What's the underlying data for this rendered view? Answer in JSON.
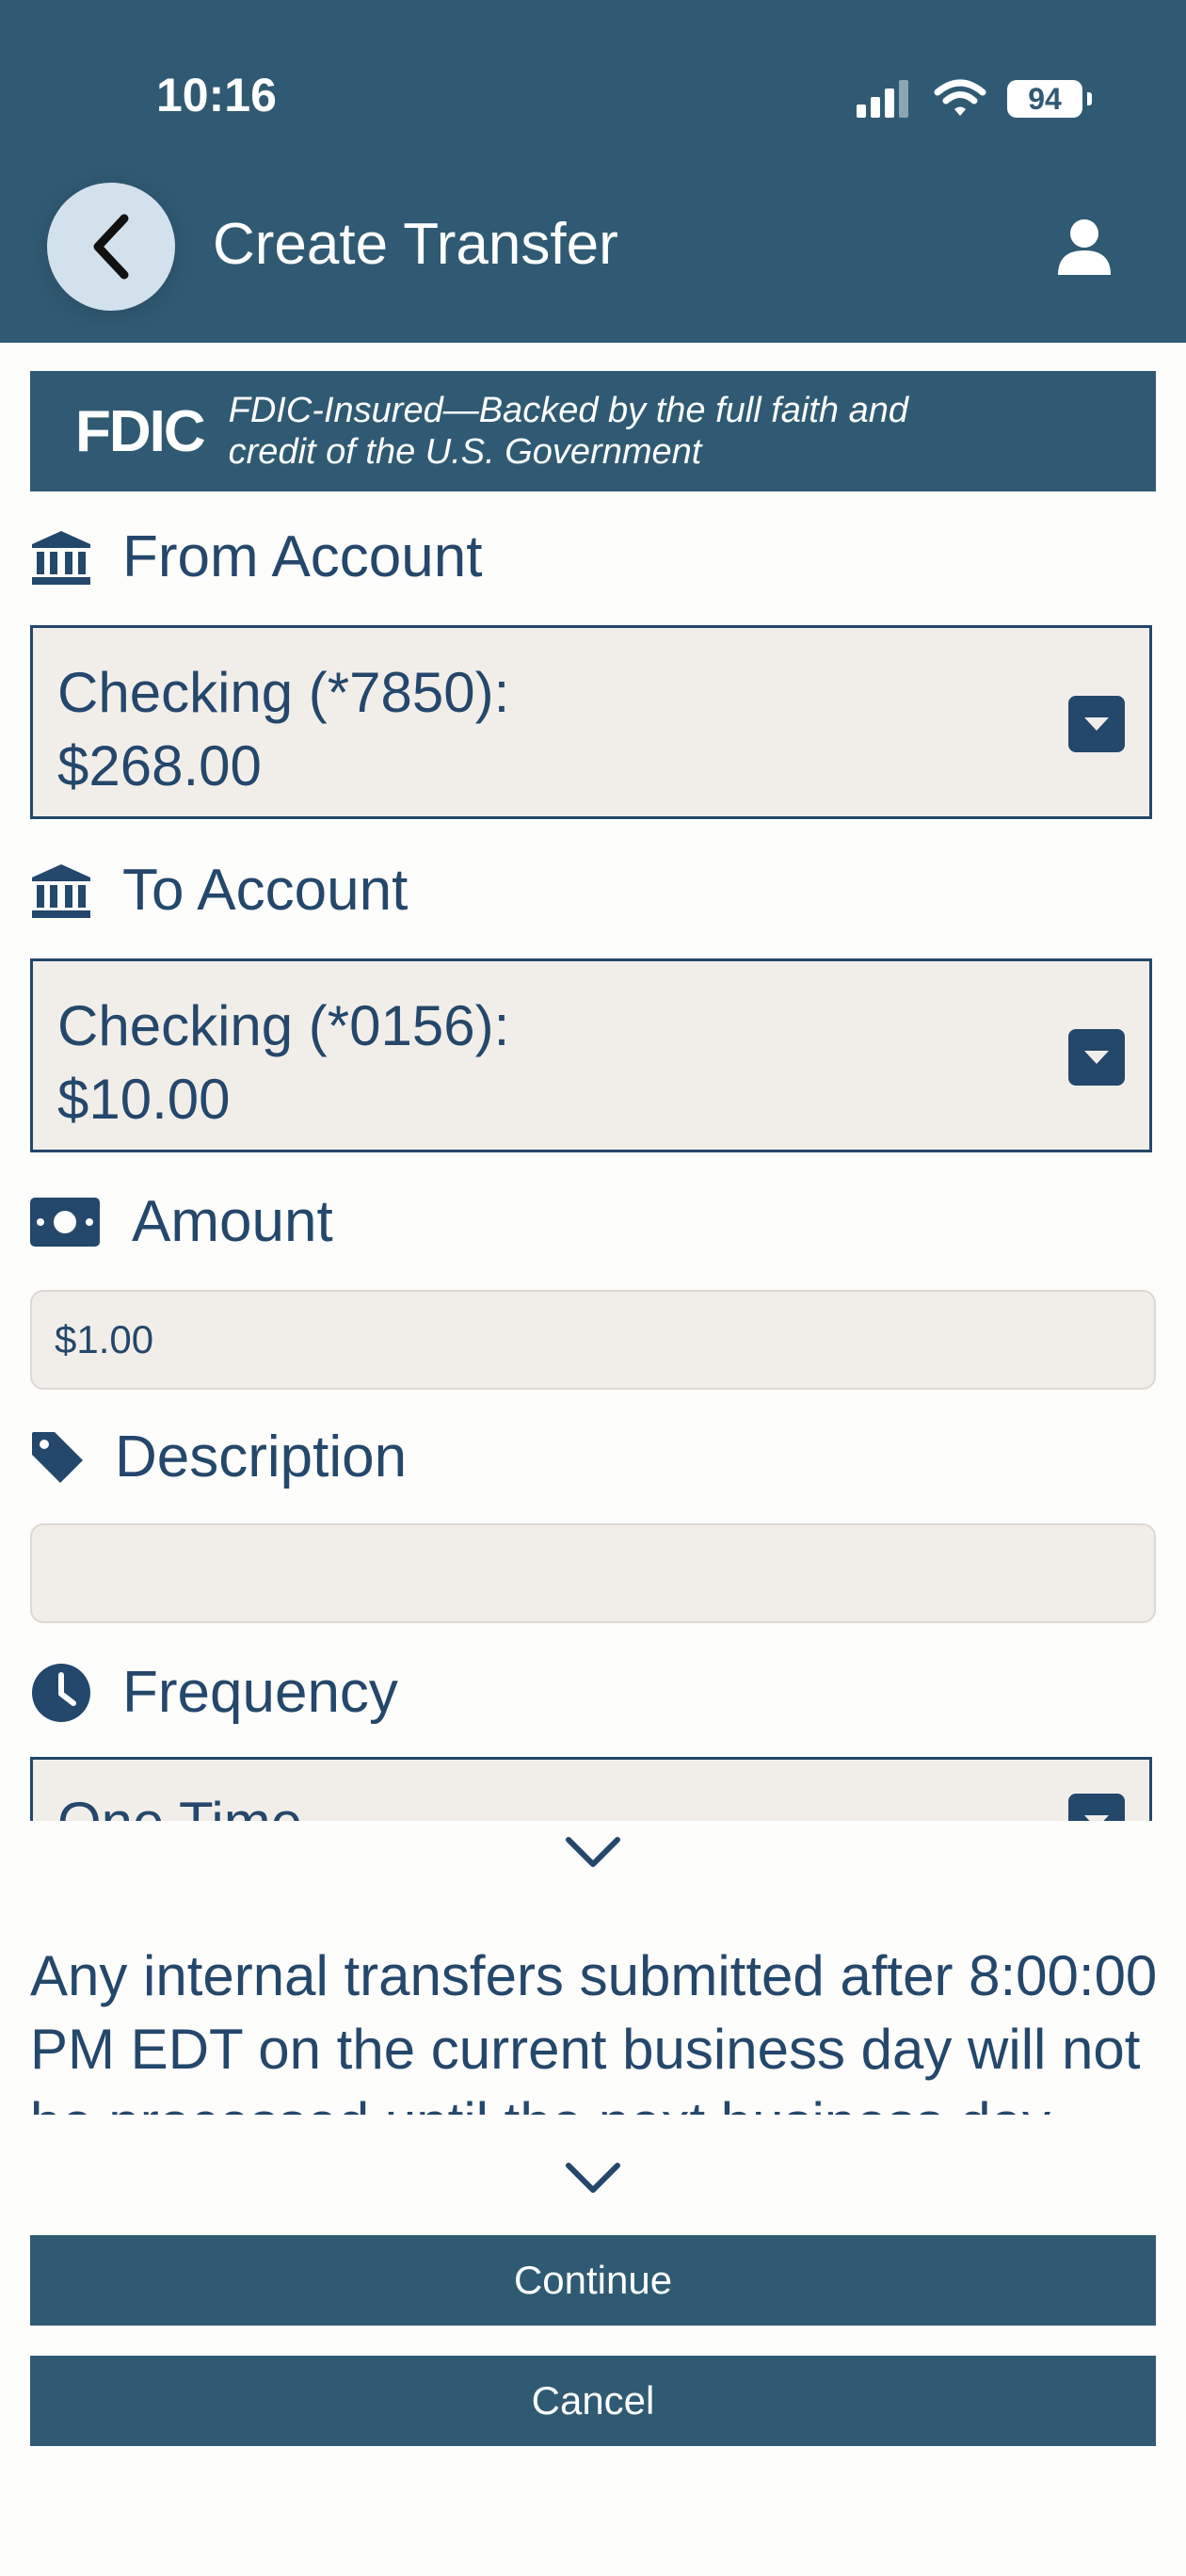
{
  "status_bar": {
    "time": "10:16",
    "battery": "94"
  },
  "header": {
    "title": "Create Transfer"
  },
  "fdic": {
    "logo": "FDIC",
    "line1": "FDIC-Insured—Backed by the full faith and",
    "line2": "credit of the U.S. Government"
  },
  "from_account": {
    "label": "From Account",
    "line1": "Checking (*7850):",
    "line2": "$268.00"
  },
  "to_account": {
    "label": "To Account",
    "line1": "Checking (*0156):",
    "line2": "$10.00"
  },
  "amount": {
    "label": "Amount",
    "value": "$1.00"
  },
  "description": {
    "label": "Description",
    "value": ""
  },
  "frequency": {
    "label": "Frequency",
    "value": "One Time"
  },
  "notice": {
    "text": "Any internal transfers submitted after 8:00:00 PM EDT on the current business day will not be processed until the next business day."
  },
  "buttons": {
    "continue": "Continue",
    "cancel": "Cancel"
  },
  "colors": {
    "header": "#305A73",
    "text": "#24476C",
    "field": "#F1EEEA"
  }
}
